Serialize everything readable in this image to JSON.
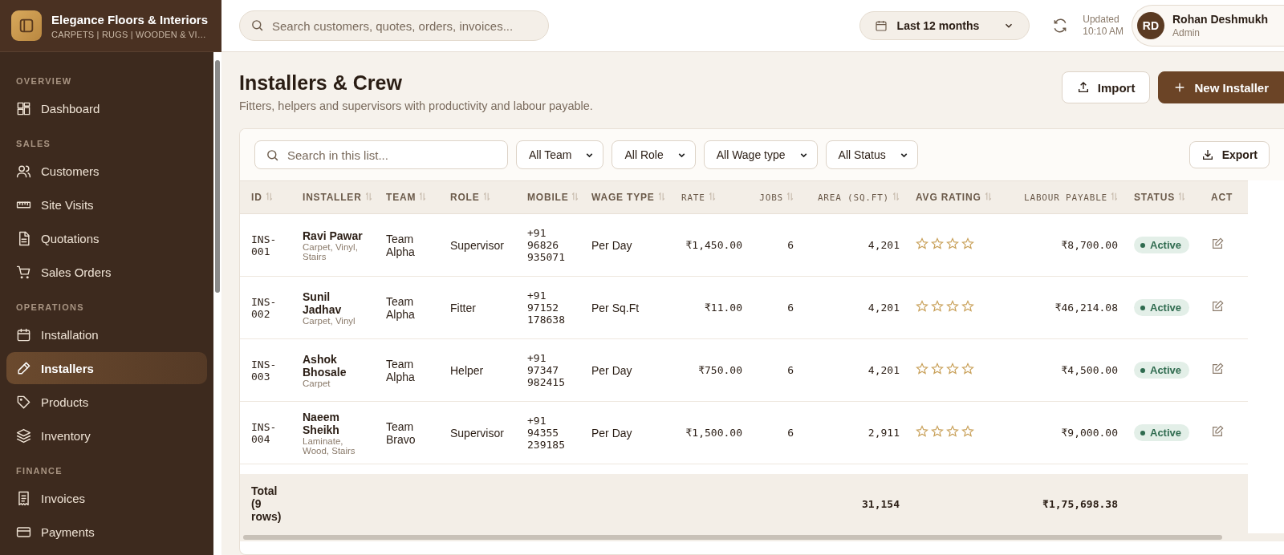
{
  "brand": {
    "name": "Elegance Floors & Interiors",
    "tagline": "CARPETS | RUGS | WOODEN & VI…"
  },
  "sidebar": {
    "sections": [
      {
        "title": "OVERVIEW",
        "items": [
          {
            "label": "Dashboard",
            "selected": false
          }
        ]
      },
      {
        "title": "SALES",
        "items": [
          {
            "label": "Customers",
            "selected": false
          },
          {
            "label": "Site Visits",
            "selected": false
          },
          {
            "label": "Quotations",
            "selected": false
          },
          {
            "label": "Sales Orders",
            "selected": false
          }
        ]
      },
      {
        "title": "OPERATIONS",
        "items": [
          {
            "label": "Installation",
            "selected": false
          },
          {
            "label": "Installers",
            "selected": true
          },
          {
            "label": "Products",
            "selected": false
          },
          {
            "label": "Inventory",
            "selected": false
          }
        ]
      },
      {
        "title": "FINANCE",
        "items": [
          {
            "label": "Invoices",
            "selected": false
          },
          {
            "label": "Payments",
            "selected": false
          }
        ]
      }
    ]
  },
  "topbar": {
    "search": {
      "placeholder": "Search customers, quotes, orders, invoices..."
    },
    "period": "Last 12 months",
    "updated_label": "Updated",
    "updated_time": "10:10 AM",
    "user": {
      "initials": "RD",
      "name": "Rohan Deshmukh",
      "role": "Admin"
    }
  },
  "page": {
    "title": "Installers & Crew",
    "subtitle": "Fitters, helpers and supervisors with productivity and labour payable.",
    "buttons": [
      {
        "label": "Import",
        "kind": "secondary"
      },
      {
        "label": "New Installer",
        "kind": "primary"
      }
    ]
  },
  "filters": {
    "search": {
      "placeholder": "Search in this list..."
    },
    "selects": [
      "All Team",
      "All Role",
      "All Wage type",
      "All Status"
    ],
    "export": "Export"
  },
  "table": {
    "columns": [
      "ID",
      "INSTALLER",
      "TEAM",
      "ROLE",
      "MOBILE",
      "WAGE TYPE",
      "RATE",
      "JOBS",
      "AREA (SQ.FT)",
      "AVG RATING",
      "LABOUR PAYABLE",
      "STATUS",
      "ACT"
    ],
    "rows": [
      {
        "id": "INS-001",
        "name": "Ravi Pawar",
        "skills": "Carpet, Vinyl, Stairs",
        "team": "Team Alpha",
        "role": "Supervisor",
        "mobile": "+91 96826 935071",
        "wage_type": "Per Day",
        "rate": "₹1,450.00",
        "jobs": "6",
        "area": "4,201",
        "stars": 0,
        "payable": "₹8,700.00",
        "status": "Active",
        "color": "#2f6b4f"
      },
      {
        "id": "INS-002",
        "name": "Sunil Jadhav",
        "skills": "Carpet, Vinyl",
        "team": "Team Alpha",
        "role": "Fitter",
        "mobile": "+91 97152 178638",
        "wage_type": "Per Sq.Ft",
        "rate": "₹11.00",
        "jobs": "6",
        "area": "4,201",
        "stars": 0,
        "payable": "₹46,214.08",
        "status": "Active",
        "color": "#2f6b4f"
      },
      {
        "id": "INS-003",
        "name": "Ashok Bhosale",
        "skills": "Carpet",
        "team": "Team Alpha",
        "role": "Helper",
        "mobile": "+91 97347 982415",
        "wage_type": "Per Day",
        "rate": "₹750.00",
        "jobs": "6",
        "area": "4,201",
        "stars": 0,
        "payable": "₹4,500.00",
        "status": "Active",
        "color": "#2f6b4f"
      },
      {
        "id": "INS-004",
        "name": "Naeem Sheikh",
        "skills": "Laminate, Wood, Stairs",
        "team": "Team Bravo",
        "role": "Supervisor",
        "mobile": "+91 94355 239185",
        "wage_type": "Per Day",
        "rate": "₹1,500.00",
        "jobs": "6",
        "area": "2,911",
        "stars": 0,
        "payable": "₹9,000.00",
        "status": "Active",
        "color": "#2f6b4f"
      }
    ],
    "total": {
      "label": "Total (9 rows)",
      "area": "31,154",
      "payable": "₹1,75,698.38"
    }
  }
}
